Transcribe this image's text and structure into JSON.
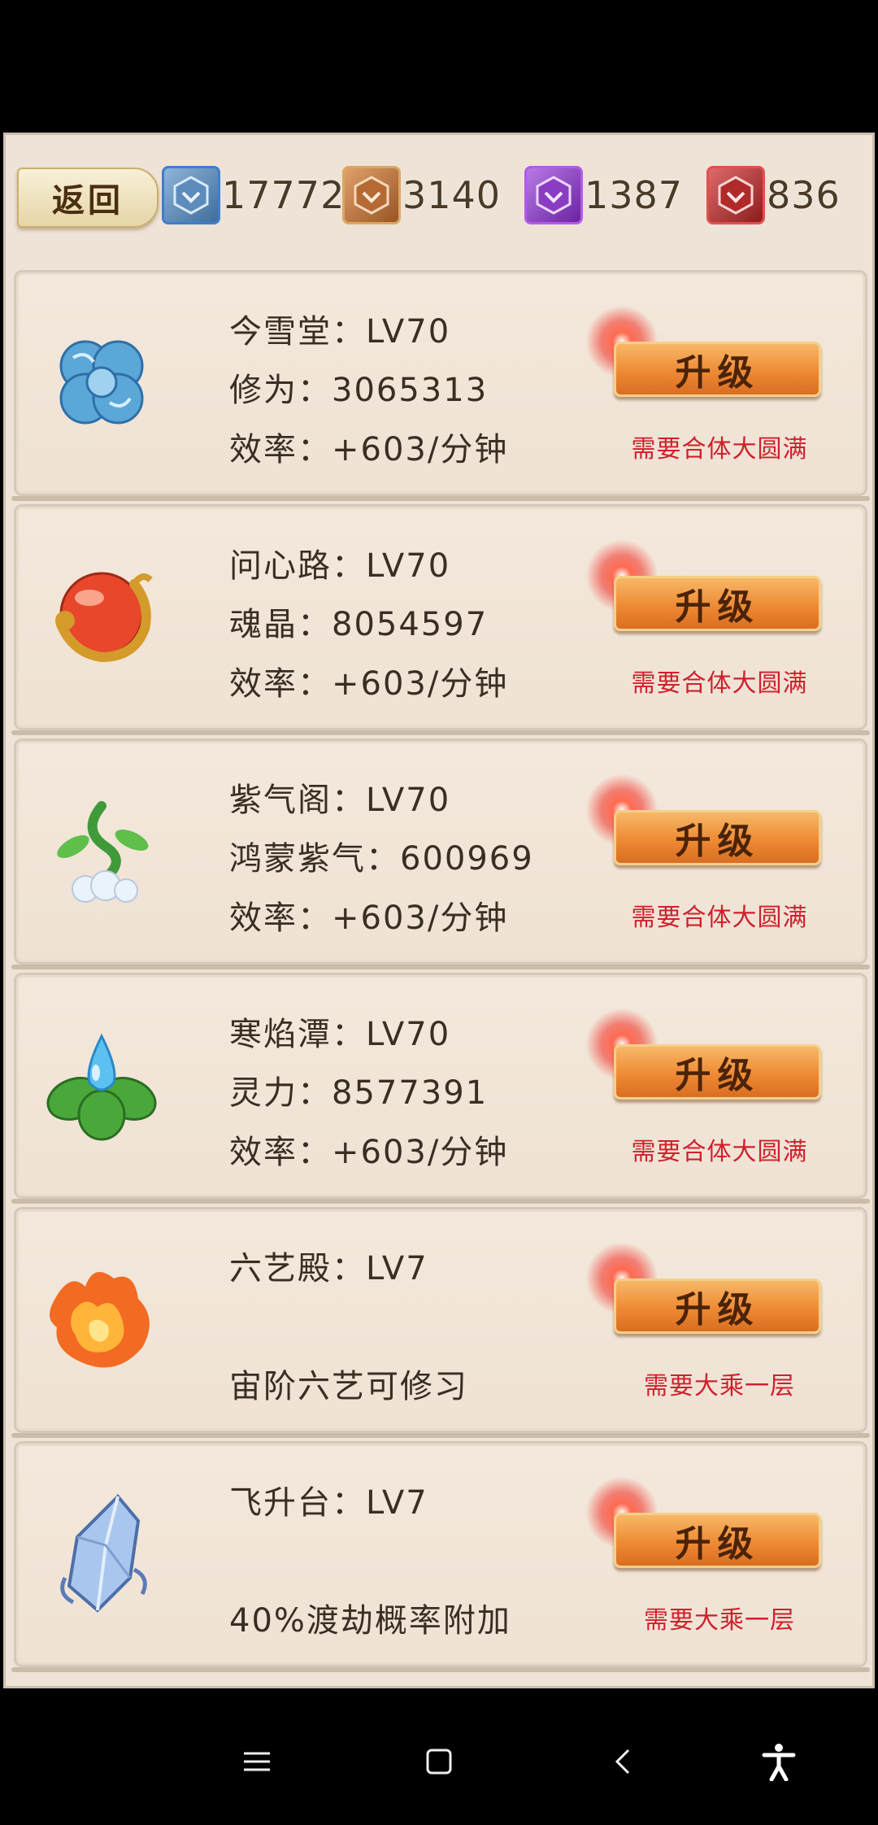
{
  "header": {
    "back_label": "返回",
    "currencies": [
      {
        "icon": "blue-crystal-icon",
        "value": "17772",
        "color": "#4a7fb8"
      },
      {
        "icon": "bronze-crystal-icon",
        "value": "3140",
        "color": "#b86a32"
      },
      {
        "icon": "purple-crystal-icon",
        "value": "1387",
        "color": "#8a3cc2"
      },
      {
        "icon": "red-crystal-icon",
        "value": "836",
        "color": "#b02a2a"
      }
    ]
  },
  "buildings": [
    {
      "icon": "cloud-swirl-icon",
      "name_level": "今雪堂：LV70",
      "resource": "修为：3065313",
      "rate": "效率：+603/分钟",
      "upgrade_label": "升级",
      "requirement": "需要合体大圆满"
    },
    {
      "icon": "dragon-orb-icon",
      "name_level": "问心路：LV70",
      "resource": "魂晶：8054597",
      "rate": "效率：+603/分钟",
      "upgrade_label": "升级",
      "requirement": "需要合体大圆满"
    },
    {
      "icon": "vine-cloud-icon",
      "name_level": "紫气阁：LV70",
      "resource": "鸿蒙紫气：600969",
      "rate": "效率：+603/分钟",
      "upgrade_label": "升级",
      "requirement": "需要合体大圆满"
    },
    {
      "icon": "water-drop-leaf-icon",
      "name_level": "寒焰潭：LV70",
      "resource": "灵力：8577391",
      "rate": "效率：+603/分钟",
      "upgrade_label": "升级",
      "requirement": "需要合体大圆满"
    },
    {
      "icon": "flame-icon",
      "name_level": "六艺殿：LV7",
      "resource": "",
      "rate": " 宙阶六艺可修习",
      "upgrade_label": "升级",
      "requirement": "需要大乘一层"
    },
    {
      "icon": "ice-crystal-icon",
      "name_level": "飞升台：LV7",
      "resource": "",
      "rate": "40%渡劫概率附加",
      "upgrade_label": "升级",
      "requirement": "需要大乘一层"
    }
  ],
  "navbar": {
    "menu_icon": "menu-icon",
    "home_icon": "home-square-icon",
    "back_icon": "back-chevron-icon",
    "accessibility_icon": "accessibility-icon"
  }
}
